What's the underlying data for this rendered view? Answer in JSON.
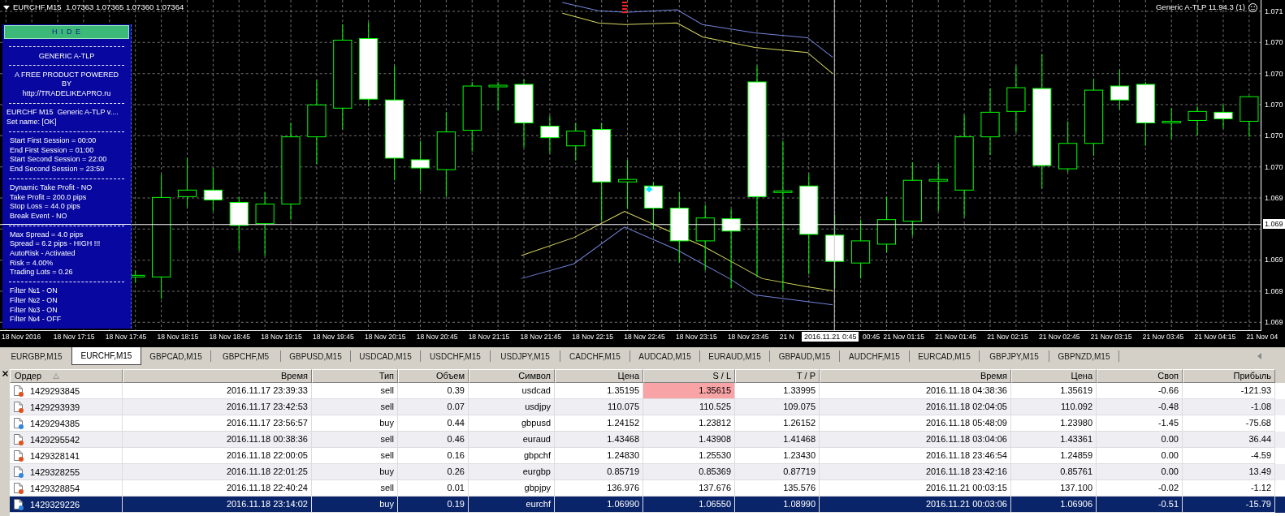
{
  "chart": {
    "title": "EURCHF,M15  1.07363 1.07365 1.07360 1.07364",
    "indicator_label": "Generic A-TLP 11.94.3 (1)",
    "info_panel": {
      "hide_button": "H I D E",
      "sections": [
        {
          "kind": "center",
          "lines": [
            "GENERIC A-TLP"
          ]
        },
        {
          "kind": "center",
          "lines": [
            "A FREE PRODUCT POWERED",
            "BY",
            "http://TRADELIKEAPRO.ru"
          ]
        },
        {
          "kind": "left",
          "lines": [
            "EURCHF M15  Generic A-TLP v....",
            "Set name: [OK]"
          ]
        },
        {
          "kind": "indent",
          "lines": [
            "Start First Session = 00:00",
            "End First Session = 01:00",
            "Start Second Session = 22:00",
            "End Second Session = 23:59"
          ]
        },
        {
          "kind": "indent",
          "lines": [
            "Dynamic Take Profit - NO",
            "Take Profit = 200.0 pips",
            "Stop Loss = 44.0 pips",
            "Break Event - NO"
          ]
        },
        {
          "kind": "indent",
          "lines": [
            "Max Spread = 4.0 pips",
            "Spread = 6.2 pips - HIGH !!!",
            "AutoRisk - Activated",
            "Risk = 4.00%",
            "Trading Lots = 0.26"
          ]
        },
        {
          "kind": "indent",
          "lines": [
            "Filter №1 - ON",
            "Filter №2 - ON",
            "Filter №3 - ON",
            "Filter №4 - OFF"
          ]
        }
      ]
    },
    "price_axis": {
      "labels": [
        "1.071",
        "1.070",
        "1.070",
        "1.070",
        "1.070",
        "1.070",
        "1.069",
        "1.069",
        "1.069",
        "1.069"
      ],
      "current_price": "1.069"
    },
    "time_axis": {
      "labels": [
        "18 Nov 2016",
        "18 Nov 17:15",
        "18 Nov 17:45",
        "18 Nov 18:15",
        "18 Nov 18:45",
        "18 Nov 19:15",
        "18 Nov 19:45",
        "18 Nov 20:15",
        "18 Nov 20:45",
        "18 Nov 21:15",
        "18 Nov 21:45",
        "18 Nov 22:15",
        "18 Nov 22:45",
        "18 Nov 23:15",
        "18 Nov 23:45",
        "21 N",
        "00:45",
        "21 Nov 01:15",
        "21 Nov 01:45",
        "21 Nov 02:15",
        "21 Nov 02:45",
        "21 Nov 03:15",
        "21 Nov 03:45",
        "21 Nov 04:15",
        "21 Nov 04"
      ],
      "crosshair_time": "2016.11.21 0:45"
    }
  },
  "symbol_tabs": [
    {
      "label": "EURGBP,M15",
      "selected": false
    },
    {
      "label": "EURCHF,M15",
      "selected": true
    },
    {
      "label": "GBPCAD,M15",
      "selected": false
    },
    {
      "label": "GBPCHF,M5",
      "selected": false
    },
    {
      "label": "GBPUSD,M15",
      "selected": false
    },
    {
      "label": "USDCAD,M15",
      "selected": false
    },
    {
      "label": "USDCHF,M15",
      "selected": false
    },
    {
      "label": "USDJPY,M15",
      "selected": false
    },
    {
      "label": "CADCHF,M15",
      "selected": false
    },
    {
      "label": "AUDCAD,M15",
      "selected": false
    },
    {
      "label": "EURAUD,M15",
      "selected": false
    },
    {
      "label": "GBPAUD,M15",
      "selected": false
    },
    {
      "label": "AUDCHF,M15",
      "selected": false
    },
    {
      "label": "EURCAD,M15",
      "selected": false
    },
    {
      "label": "GBPJPY,M15",
      "selected": false
    },
    {
      "label": "GBPNZD,M15",
      "selected": false
    }
  ],
  "orders": {
    "columns": [
      {
        "label": "Ордер",
        "sorted": true
      },
      {
        "label": "Время",
        "sorted": false
      },
      {
        "label": "Тип",
        "sorted": false
      },
      {
        "label": "Объем",
        "sorted": false
      },
      {
        "label": "Символ",
        "sorted": false
      },
      {
        "label": "Цена",
        "sorted": false
      },
      {
        "label": "S / L",
        "sorted": false
      },
      {
        "label": "T / P",
        "sorted": false
      },
      {
        "label": "Время",
        "sorted": false
      },
      {
        "label": "Цена",
        "sorted": false
      },
      {
        "label": "Своп",
        "sorted": false
      },
      {
        "label": "Прибыль",
        "sorted": false
      }
    ],
    "rows": [
      {
        "cells": [
          "1429293845",
          "2016.11.17 23:39:33",
          "sell",
          "0.39",
          "usdcad",
          "1.35195",
          "1.35615",
          "1.33995",
          "2016.11.18 04:38:36",
          "1.35619",
          "-0.66",
          "-121.93"
        ],
        "color": "#e0521d",
        "selected": false,
        "sl_highlighted": true
      },
      {
        "cells": [
          "1429293939",
          "2016.11.17 23:42:53",
          "sell",
          "0.07",
          "usdjpy",
          "110.075",
          "110.525",
          "109.075",
          "2016.11.18 02:04:05",
          "110.092",
          "-0.48",
          "-1.08"
        ],
        "color": "#e0521d",
        "selected": false,
        "sl_highlighted": false
      },
      {
        "cells": [
          "1429294385",
          "2016.11.17 23:56:57",
          "buy",
          "0.44",
          "gbpusd",
          "1.24152",
          "1.23812",
          "1.26152",
          "2016.11.18 05:48:09",
          "1.23980",
          "-1.45",
          "-75.68"
        ],
        "color": "#2e86de",
        "selected": false,
        "sl_highlighted": false
      },
      {
        "cells": [
          "1429295542",
          "2016.11.18 00:38:36",
          "sell",
          "0.46",
          "euraud",
          "1.43468",
          "1.43908",
          "1.41468",
          "2016.11.18 03:04:06",
          "1.43361",
          "0.00",
          "36.44"
        ],
        "color": "#e0521d",
        "selected": false,
        "sl_highlighted": false
      },
      {
        "cells": [
          "1429328141",
          "2016.11.18 22:00:05",
          "sell",
          "0.16",
          "gbpchf",
          "1.24830",
          "1.25530",
          "1.23430",
          "2016.11.18 23:46:54",
          "1.24859",
          "0.00",
          "-4.59"
        ],
        "color": "#e0521d",
        "selected": false,
        "sl_highlighted": false
      },
      {
        "cells": [
          "1429328255",
          "2016.11.18 22:01:25",
          "buy",
          "0.26",
          "eurgbp",
          "0.85719",
          "0.85369",
          "0.87719",
          "2016.11.18 23:42:16",
          "0.85761",
          "0.00",
          "13.49"
        ],
        "color": "#2e86de",
        "selected": false,
        "sl_highlighted": false
      },
      {
        "cells": [
          "1429328854",
          "2016.11.18 22:40:24",
          "sell",
          "0.01",
          "gbpjpy",
          "136.976",
          "137.676",
          "135.576",
          "2016.11.21 00:03:15",
          "137.100",
          "-0.02",
          "-1.12"
        ],
        "color": "#e0521d",
        "selected": false,
        "sl_highlighted": false
      },
      {
        "cells": [
          "1429329226",
          "2016.11.18 23:14:02",
          "buy",
          "0.19",
          "eurchf",
          "1.06990",
          "1.06550",
          "1.08990",
          "2016.11.21 00:03:06",
          "1.06906",
          "-0.51",
          "-15.79"
        ],
        "color": "#2e86de",
        "selected": true,
        "sl_highlighted": false
      }
    ]
  }
}
